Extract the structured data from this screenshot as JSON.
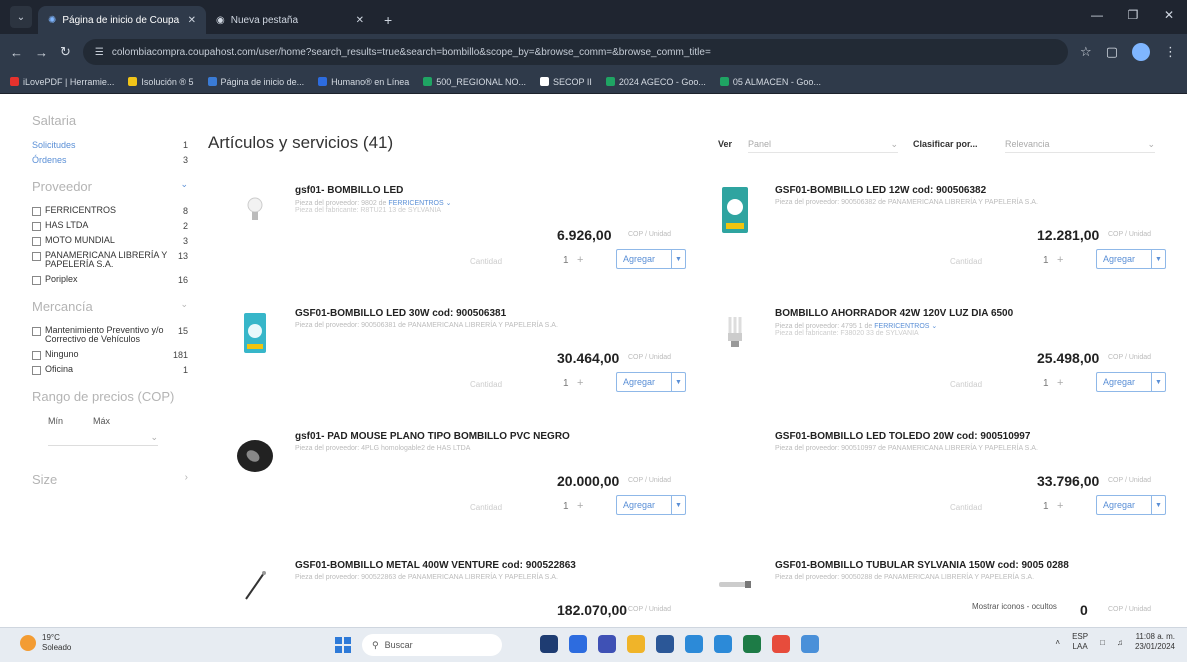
{
  "browser": {
    "tabs": [
      {
        "title": "Página de inicio de Coupa",
        "active": true
      },
      {
        "title": "Nueva pestaña",
        "active": false
      }
    ],
    "url": "colombiacompra.coupahost.com/user/home?search_results=true&search=bombillo&scope_by=&browse_comm=&browse_comm_title=",
    "bookmarks": [
      {
        "label": "iLovePDF | Herramie...",
        "color": "#e5322d"
      },
      {
        "label": "Isolución ® 5",
        "color": "#f0c419"
      },
      {
        "label": "Página de inicio de...",
        "color": "#3a7bd5"
      },
      {
        "label": "Humano® en Línea",
        "color": "#2d6cdf"
      },
      {
        "label": "500_REGIONAL NO...",
        "color": "#1fa463"
      },
      {
        "label": "SECOP II",
        "color": "#ffffff"
      },
      {
        "label": "2024 AGECO - Goo...",
        "color": "#1fa463"
      },
      {
        "label": "05 ALMACEN - Goo...",
        "color": "#1fa463"
      }
    ]
  },
  "sidebar": {
    "filter_heading": "Saltaria",
    "links": [
      {
        "label": "Solicitudes",
        "count": "1"
      },
      {
        "label": "Órdenes",
        "count": "3"
      }
    ],
    "suppliers_heading": "Proveedor",
    "suppliers": [
      {
        "label": "FERRICENTROS",
        "count": "8"
      },
      {
        "label": "HAS LTDA",
        "count": "2"
      },
      {
        "label": "MOTO MUNDIAL",
        "count": "3"
      },
      {
        "label": "PANAMERICANA LIBRERÍA Y PAPELERÍA S.A.",
        "count": "13"
      },
      {
        "label": "Poriplex",
        "count": "16"
      }
    ],
    "commodity_heading": "Mercancía",
    "commodities": [
      {
        "label": "Mantenimiento Preventivo y/o Correctivo de Vehículos",
        "count": "15"
      },
      {
        "label": "Ninguno",
        "count": "181"
      },
      {
        "label": "Oficina",
        "count": "1"
      }
    ],
    "price_heading": "Rango de precios (COP)",
    "min_label": "Mín",
    "max_label": "Máx",
    "size_heading": "Size"
  },
  "content": {
    "title": "Artículos y servicios (41)",
    "view_label": "Ver",
    "view_value": "Panel",
    "sort_label": "Clasificar por...",
    "sort_value": "Relevancia",
    "add_label": "Agregar",
    "qty_label": "Cantidad",
    "qty_value": "1",
    "items": [
      {
        "name": "gsf01- BOMBILLO LED",
        "supplier": "Pieza del proveedor: 9802 de",
        "supplier_name": "FERRICENTROS",
        "manufacturer": "Pieza del fabricante: R8TU21 13 de SYLVANIA",
        "price": "6.926,00",
        "unit": "COP / Unidad",
        "thumb": "small-bulb"
      },
      {
        "name": "GSF01-BOMBILLO LED 12W cod: 900506382",
        "supplier": "Pieza del proveedor: 900506382 de PANAMERICANA LIBRERÍA Y PAPELERÍA S.A.",
        "supplier_name": "",
        "manufacturer": "",
        "price": "12.281,00",
        "unit": "COP / Unidad",
        "thumb": "led-box"
      },
      {
        "name": "GSF01-BOMBILLO LED 30W cod: 900506381",
        "supplier": "Pieza del proveedor: 900506381 de PANAMERICANA LIBRERÍA Y PAPELERÍA S.A.",
        "supplier_name": "",
        "manufacturer": "",
        "price": "30.464,00",
        "unit": "COP / Unidad",
        "thumb": "led-box-teal"
      },
      {
        "name": "BOMBILLO AHORRADOR 42W 120V LUZ DIA 6500",
        "supplier": "Pieza del proveedor: 4795 1 de",
        "supplier_name": "FERRICENTROS",
        "manufacturer": "Pieza del fabricante: F38020 33 de SYLVANIA",
        "price": "25.498,00",
        "unit": "COP / Unidad",
        "thumb": "cfl-bulb"
      },
      {
        "name": "gsf01- PAD MOUSE PLANO TIPO BOMBILLO PVC NEGRO",
        "supplier": "Pieza del proveedor: 4PLG homologable2 de HAS LTDA",
        "supplier_name": "",
        "manufacturer": "",
        "price": "20.000,00",
        "unit": "COP / Unidad",
        "thumb": "mouse-pad"
      },
      {
        "name": "GSF01-BOMBILLO LED TOLEDO 20W cod: 900510997",
        "supplier": "Pieza del proveedor: 900510997 de PANAMERICANA LIBRERÍA Y PAPELERÍA S.A.",
        "supplier_name": "",
        "manufacturer": "",
        "price": "33.796,00",
        "unit": "COP / Unidad",
        "thumb": "none"
      },
      {
        "name": "GSF01-BOMBILLO METAL 400W VENTURE cod: 900522863",
        "supplier": "Pieza del proveedor: 900522863 de PANAMERICANA LIBRERÍA Y PAPELERÍA S.A.",
        "supplier_name": "",
        "manufacturer": "",
        "price": "182.070,00",
        "unit": "COP / Unidad",
        "thumb": "metal-bulb"
      },
      {
        "name": "GSF01-BOMBILLO TUBULAR SYLVANIA 150W cod: 9005 0288",
        "supplier": "Pieza del proveedor: 90050288 de PANAMERICANA LIBRERÍA Y PAPELERÍA S.A.",
        "supplier_name": "",
        "manufacturer": "",
        "price": "",
        "unit": "COP / Unidad",
        "thumb": "tube-bulb"
      }
    ],
    "show_icons_label": "Mostrar iconos - ocultos",
    "show_icons_value": "0"
  },
  "taskbar": {
    "temp": "19°C",
    "weather": "Soleado",
    "search_placeholder": "Buscar",
    "lang_top": "ESP",
    "lang_bottom": "LAA",
    "time": "11:08 a. m.",
    "date": "23/01/2024",
    "app_colors": [
      "#1e3c72",
      "#2d6cdf",
      "#3f51b5",
      "#f0b429",
      "#2b5797",
      "#2c8ad8",
      "#2c8ad8",
      "#1d7b46",
      "#e74c3c",
      "#4a90d9"
    ]
  }
}
